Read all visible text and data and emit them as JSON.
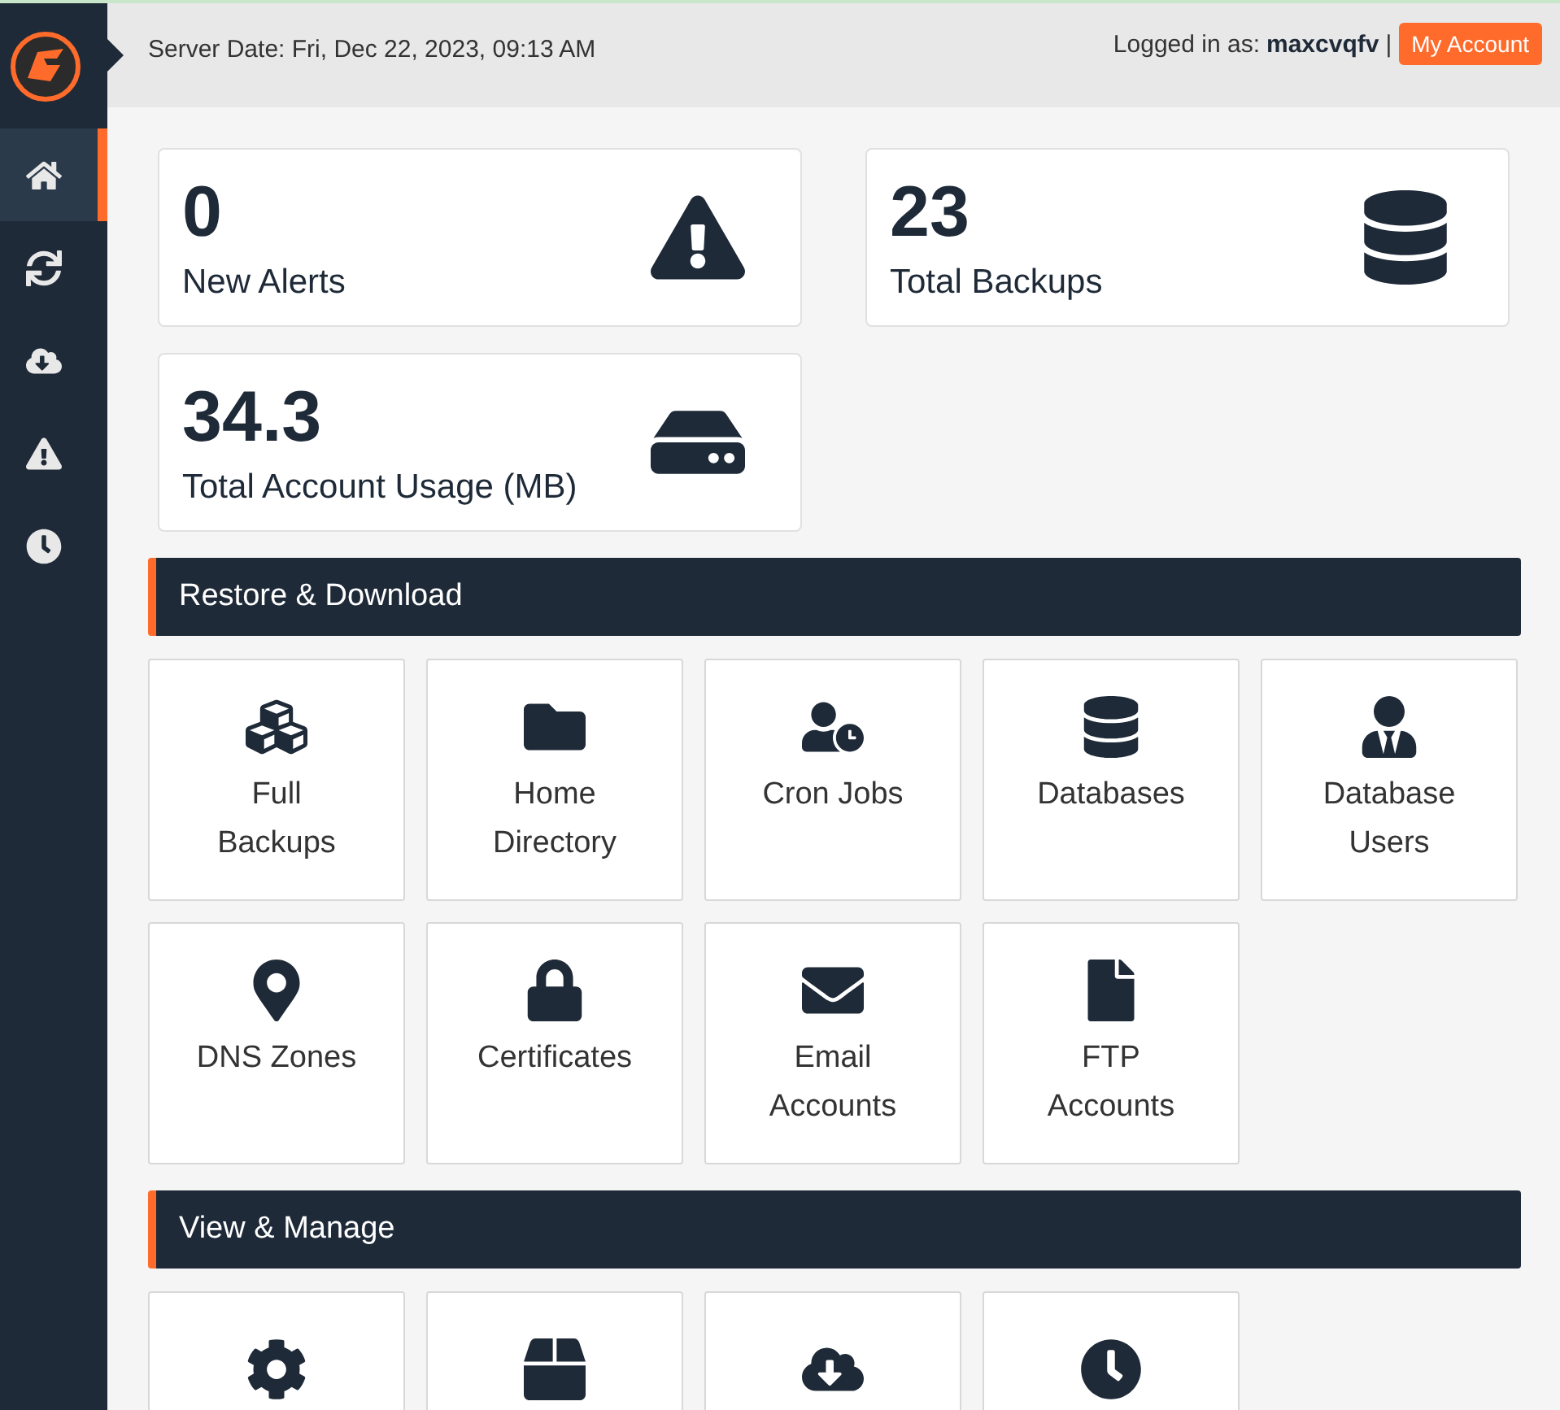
{
  "sidebar": {
    "items": [
      {
        "selected": true
      },
      {
        "selected": false
      },
      {
        "selected": false
      },
      {
        "selected": false
      },
      {
        "selected": false
      }
    ]
  },
  "header": {
    "server_date": "Server Date: Fri, Dec 22, 2023, 09:13 AM",
    "logged_in_label": "Logged in as:",
    "username": "maxcvqfv",
    "separator": "|",
    "account_button": "My Account"
  },
  "stats": [
    {
      "value": "0",
      "label": "New Alerts"
    },
    {
      "value": "23",
      "label": "Total Backups"
    },
    {
      "value": "34.3",
      "label": "Total Account Usage (MB)"
    }
  ],
  "sections": [
    {
      "title": "Restore & Download",
      "tiles": [
        {
          "label": "Full Backups"
        },
        {
          "label": "Home Directory"
        },
        {
          "label": "Cron Jobs"
        },
        {
          "label": "Databases"
        },
        {
          "label": "Database Users"
        },
        {
          "label": "DNS Zones"
        },
        {
          "label": "Certificates"
        },
        {
          "label": "Email Accounts"
        },
        {
          "label": "FTP Accounts"
        }
      ]
    },
    {
      "title": "View & Manage",
      "tiles": [
        {
          "kind": "icon"
        },
        {
          "kind": "icon"
        },
        {
          "kind": "icon"
        },
        {
          "kind": "icon"
        }
      ]
    }
  ]
}
